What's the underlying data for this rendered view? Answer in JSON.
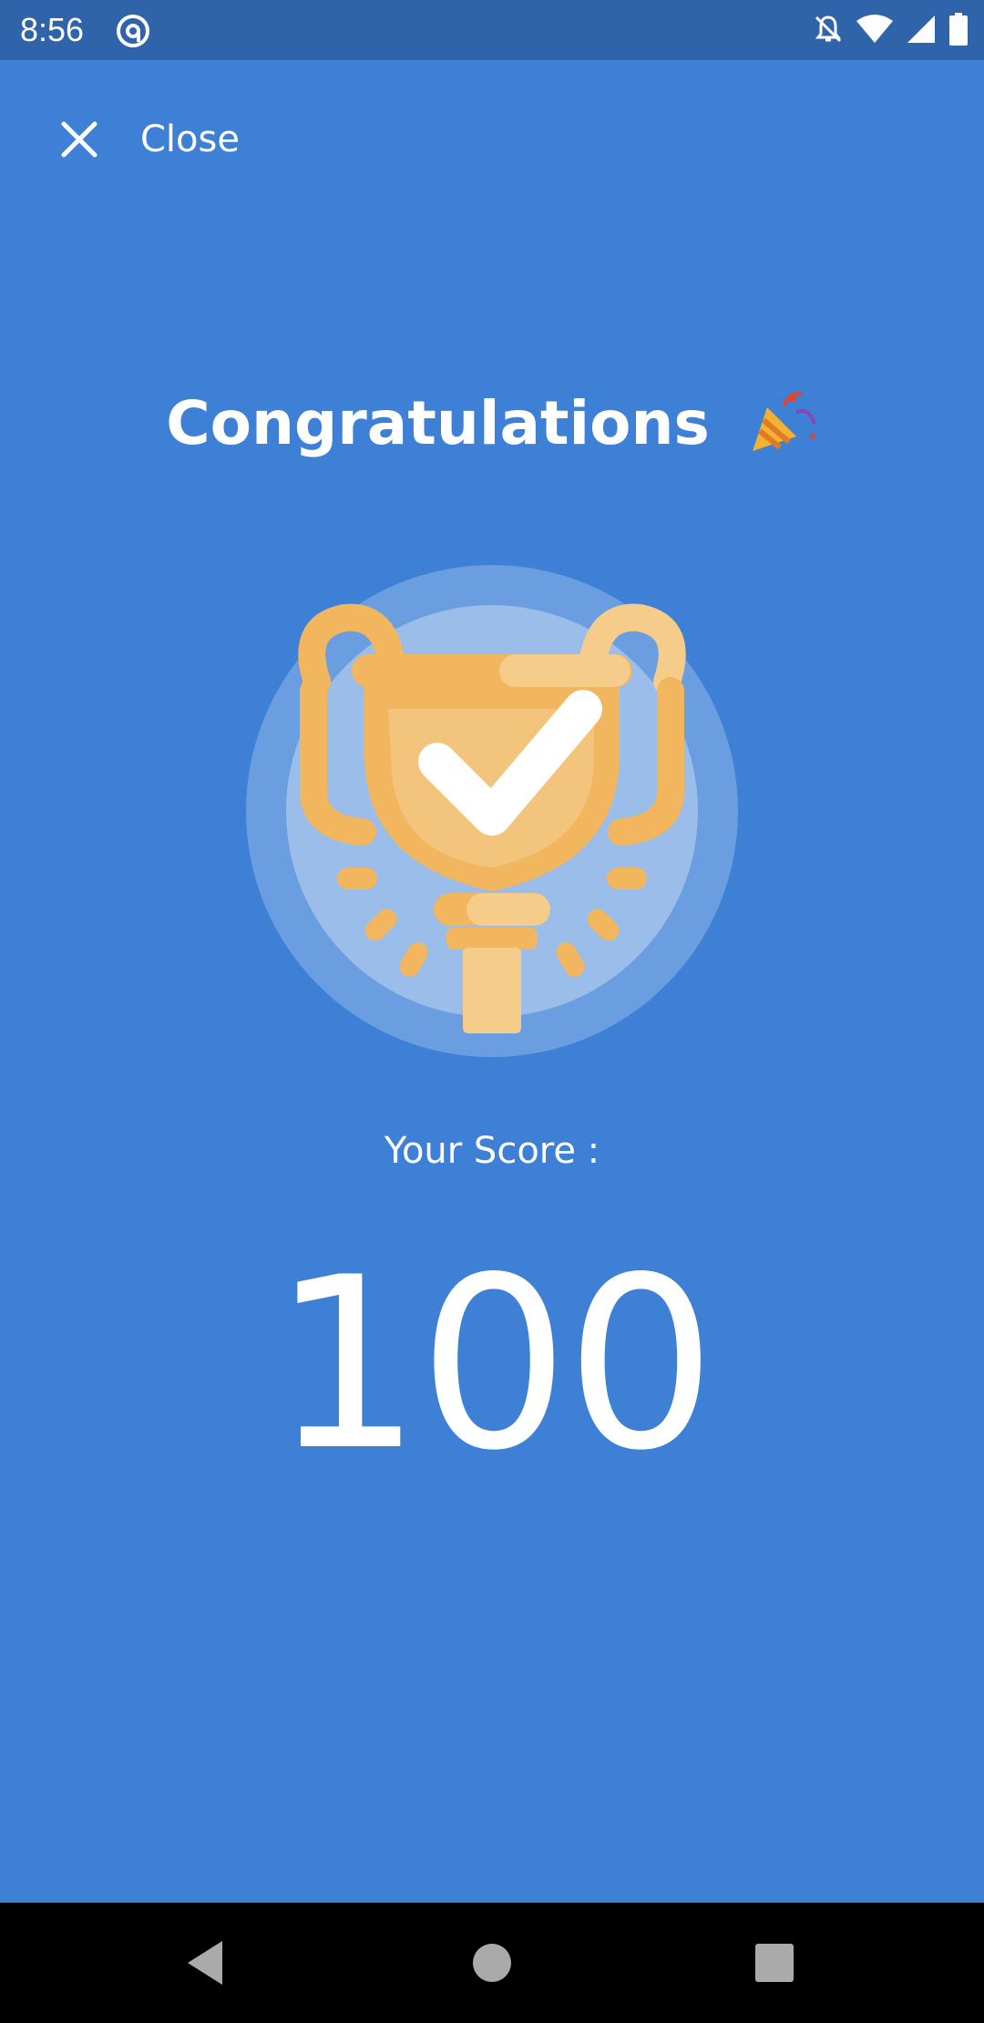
{
  "status_bar": {
    "time": "8:56",
    "icons": [
      "at-sign-icon",
      "bell-off-icon",
      "wifi-icon",
      "cell-signal-icon",
      "battery-icon"
    ]
  },
  "header": {
    "close_label": "Close",
    "close_icon": "close-icon"
  },
  "main": {
    "title": "Congratulations",
    "title_emoji_icon": "party-popper-icon",
    "illustration": "trophy-checkmark-icon",
    "score_label": "Your Score :",
    "score_value": "100"
  },
  "nav_bar": {
    "buttons": [
      "back-icon",
      "home-icon",
      "recents-icon"
    ]
  },
  "colors": {
    "background": "#3d80d6",
    "status_bar": "#2f64ab",
    "trophy_gold": "#f1b65e",
    "trophy_light": "#f5cc8a",
    "text": "#ffffff"
  }
}
